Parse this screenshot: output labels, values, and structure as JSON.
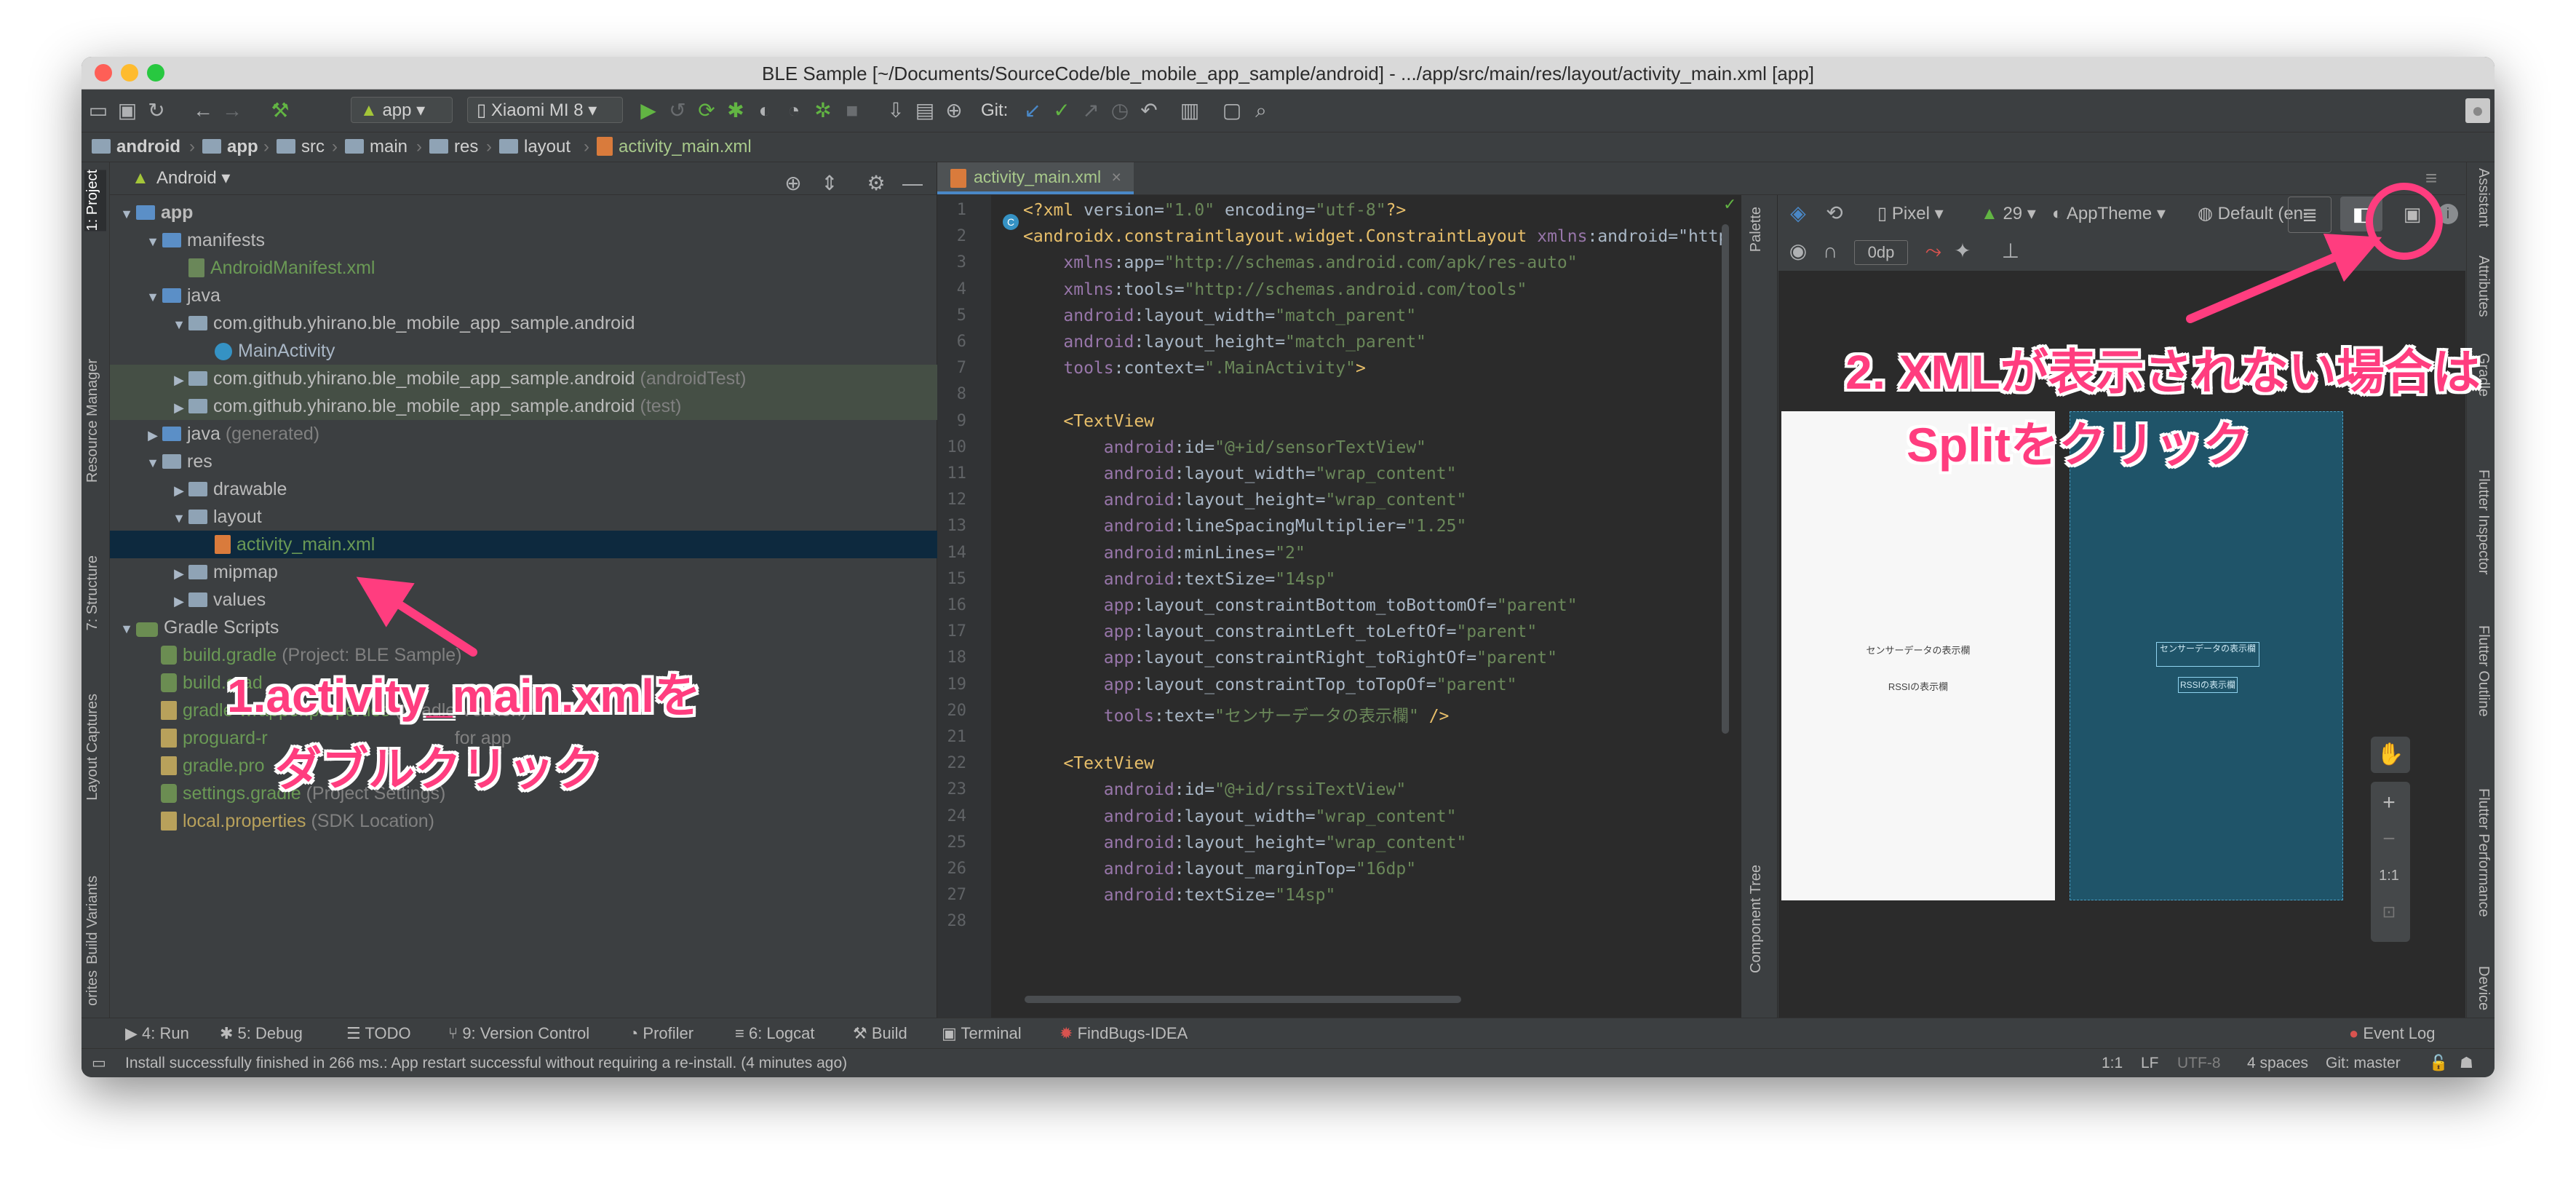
{
  "window": {
    "title": "BLE Sample [~/Documents/SourceCode/ble_mobile_app_sample/android] - .../app/src/main/res/layout/activity_main.xml [app]"
  },
  "toolbar": {
    "run_config": "app",
    "device": "Xiaomi MI 8",
    "git_label": "Git:"
  },
  "breadcrumb": [
    "android",
    "app",
    "src",
    "main",
    "res",
    "layout",
    "activity_main.xml"
  ],
  "project_panel": {
    "view_mode": "Android"
  },
  "left_tool_tabs": [
    "1: Project",
    "Resource Manager",
    "7: Structure",
    "Layout Captures",
    "Build Variants",
    "orites"
  ],
  "right_tool_tabs": [
    "Assistant",
    "Attributes",
    "Gradle",
    "Flutter Inspector",
    "Flutter Outline",
    "Flutter Performance",
    "Device"
  ],
  "tree": [
    {
      "label": "app",
      "suffix": ""
    },
    {
      "label": "manifests",
      "suffix": ""
    },
    {
      "label": "AndroidManifest.xml",
      "suffix": ""
    },
    {
      "label": "java",
      "suffix": ""
    },
    {
      "label": "com.github.yhirano.ble_mobile_app_sample.android",
      "suffix": ""
    },
    {
      "label": "MainActivity",
      "suffix": ""
    },
    {
      "label": "com.github.yhirano.ble_mobile_app_sample.android",
      "suffix": "(androidTest)"
    },
    {
      "label": "com.github.yhirano.ble_mobile_app_sample.android",
      "suffix": "(test)"
    },
    {
      "label": "java",
      "suffix": "(generated)"
    },
    {
      "label": "res",
      "suffix": ""
    },
    {
      "label": "drawable",
      "suffix": ""
    },
    {
      "label": "layout",
      "suffix": ""
    },
    {
      "label": "activity_main.xml",
      "suffix": ""
    },
    {
      "label": "mipmap",
      "suffix": ""
    },
    {
      "label": "values",
      "suffix": ""
    },
    {
      "label": "Gradle Scripts",
      "suffix": ""
    },
    {
      "label": "build.gradle",
      "suffix": "(Project: BLE Sample)"
    },
    {
      "label": "build.grad",
      "suffix": ""
    },
    {
      "label": "gradle-wrapper.properties",
      "suffix": "(Gradle Version)"
    },
    {
      "label": "proguard-r",
      "suffix": "for app"
    },
    {
      "label": "gradle.pro",
      "suffix": ""
    },
    {
      "label": "settings.gradle",
      "suffix": "(Project Settings)"
    },
    {
      "label": "local.properties",
      "suffix": "(SDK Location)"
    }
  ],
  "editor": {
    "tab_label": "activity_main.xml"
  },
  "code_lines": [
    {
      "n": "1",
      "t": "<?xml version=\"1.0\" encoding=\"utf-8\"?>"
    },
    {
      "n": "2",
      "t": "<androidx.constraintlayout.widget.ConstraintLayout xmlns:android=\"http"
    },
    {
      "n": "3",
      "t": "    xmlns:app=\"http://schemas.android.com/apk/res-auto\""
    },
    {
      "n": "4",
      "t": "    xmlns:tools=\"http://schemas.android.com/tools\""
    },
    {
      "n": "5",
      "t": "    android:layout_width=\"match_parent\""
    },
    {
      "n": "6",
      "t": "    android:layout_height=\"match_parent\""
    },
    {
      "n": "7",
      "t": "    tools:context=\".MainActivity\">"
    },
    {
      "n": "8",
      "t": ""
    },
    {
      "n": "9",
      "t": "    <TextView"
    },
    {
      "n": "10",
      "t": "        android:id=\"@+id/sensorTextView\""
    },
    {
      "n": "11",
      "t": "        android:layout_width=\"wrap_content\""
    },
    {
      "n": "12",
      "t": "        android:layout_height=\"wrap_content\""
    },
    {
      "n": "13",
      "t": "        android:lineSpacingMultiplier=\"1.25\""
    },
    {
      "n": "14",
      "t": "        android:minLines=\"2\""
    },
    {
      "n": "15",
      "t": "        android:textSize=\"14sp\""
    },
    {
      "n": "16",
      "t": "        app:layout_constraintBottom_toBottomOf=\"parent\""
    },
    {
      "n": "17",
      "t": "        app:layout_constraintLeft_toLeftOf=\"parent\""
    },
    {
      "n": "18",
      "t": "        app:layout_constraintRight_toRightOf=\"parent\""
    },
    {
      "n": "19",
      "t": "        app:layout_constraintTop_toTopOf=\"parent\""
    },
    {
      "n": "20",
      "t": "        tools:text=\"センサーデータの表示欄\" />"
    },
    {
      "n": "21",
      "t": ""
    },
    {
      "n": "22",
      "t": "    <TextView"
    },
    {
      "n": "23",
      "t": "        android:id=\"@+id/rssiTextView\""
    },
    {
      "n": "24",
      "t": "        android:layout_width=\"wrap_content\""
    },
    {
      "n": "25",
      "t": "        android:layout_height=\"wrap_content\""
    },
    {
      "n": "26",
      "t": "        android:layout_marginTop=\"16dp\""
    },
    {
      "n": "27",
      "t": "        android:textSize=\"14sp\""
    },
    {
      "n": "28",
      "t": ""
    }
  ],
  "design": {
    "device": "Pixel",
    "api": "29",
    "theme": "AppTheme",
    "locale": "Default (en-us)",
    "margin": "0dp",
    "zoom_ratio": "1:1",
    "palette_label": "Palette",
    "component_tree_label": "Component Tree",
    "preview_sensor_text": "センサーデータの表示欄",
    "preview_rssi_text": "RSSIの表示欄"
  },
  "bottom_tools": [
    "4: Run",
    "5: Debug",
    "TODO",
    "9: Version Control",
    "Profiler",
    "6: Logcat",
    "Build",
    "Terminal",
    "FindBugs-IDEA"
  ],
  "event_log": "Event Log",
  "status": {
    "message": "Install successfully finished in 266 ms.: App restart successful without requiring a re-install. (4 minutes ago)",
    "position": "1:1",
    "line_sep": "LF",
    "encoding": "UTF-8",
    "indent": "4 spaces",
    "git": "Git: master"
  },
  "annotations": {
    "step1_line1": "1.activity_main.xmlを",
    "step1_line2": "ダブルクリック",
    "step2_line1": "2. XMLが表示されない場合は",
    "step2_line2": "Splitをクリック",
    "accent_color": "#ff3d7f"
  }
}
